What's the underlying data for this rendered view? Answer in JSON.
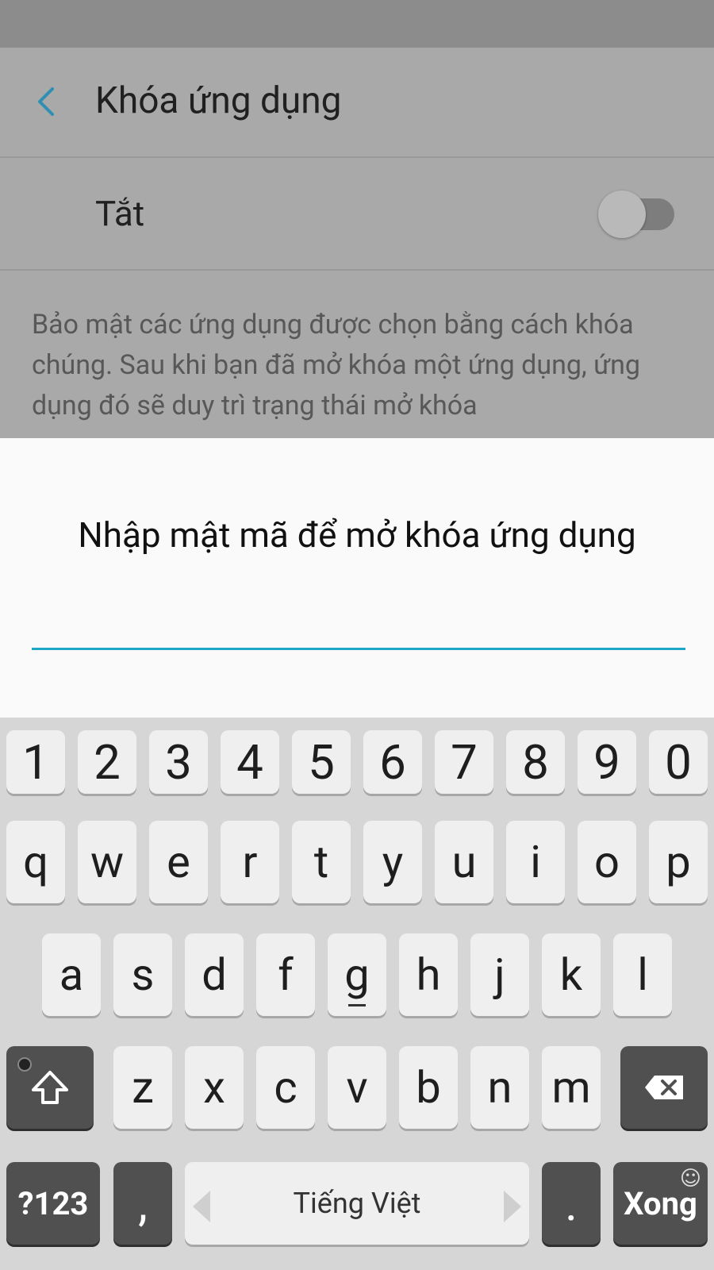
{
  "app": {
    "title": "Khóa ứng dụng"
  },
  "toggle_row": {
    "label": "Tắt",
    "state": "off"
  },
  "description": "Bảo mật các ứng dụng được chọn bằng cách khóa chúng. Sau khi bạn đã mở khóa một ứng dụng, ứng dụng đó sẽ duy trì trạng thái mở khóa",
  "dialog": {
    "prompt": "Nhập mật mã để mở khóa ứng dụng",
    "input_value": ""
  },
  "keyboard": {
    "row_numbers": [
      "1",
      "2",
      "3",
      "4",
      "5",
      "6",
      "7",
      "8",
      "9",
      "0"
    ],
    "row1": [
      "q",
      "w",
      "e",
      "r",
      "t",
      "y",
      "u",
      "i",
      "o",
      "p"
    ],
    "row2": [
      "a",
      "s",
      "d",
      "f",
      "g",
      "h",
      "j",
      "k",
      "l"
    ],
    "row3": [
      "z",
      "x",
      "c",
      "v",
      "b",
      "n",
      "m"
    ],
    "symbols_key": "?123",
    "comma_key": ",",
    "space_label": "Tiếng Việt",
    "period_key": ".",
    "done_key": "Xong"
  },
  "colors": {
    "accent": "#1ea6c7",
    "dim_background": "#a9a9a9",
    "dialog": "#fafafa"
  },
  "icons": {
    "back": "chevron-left-icon",
    "shift": "shift-icon",
    "delete": "backspace-icon",
    "emoji": "smiley-icon"
  }
}
